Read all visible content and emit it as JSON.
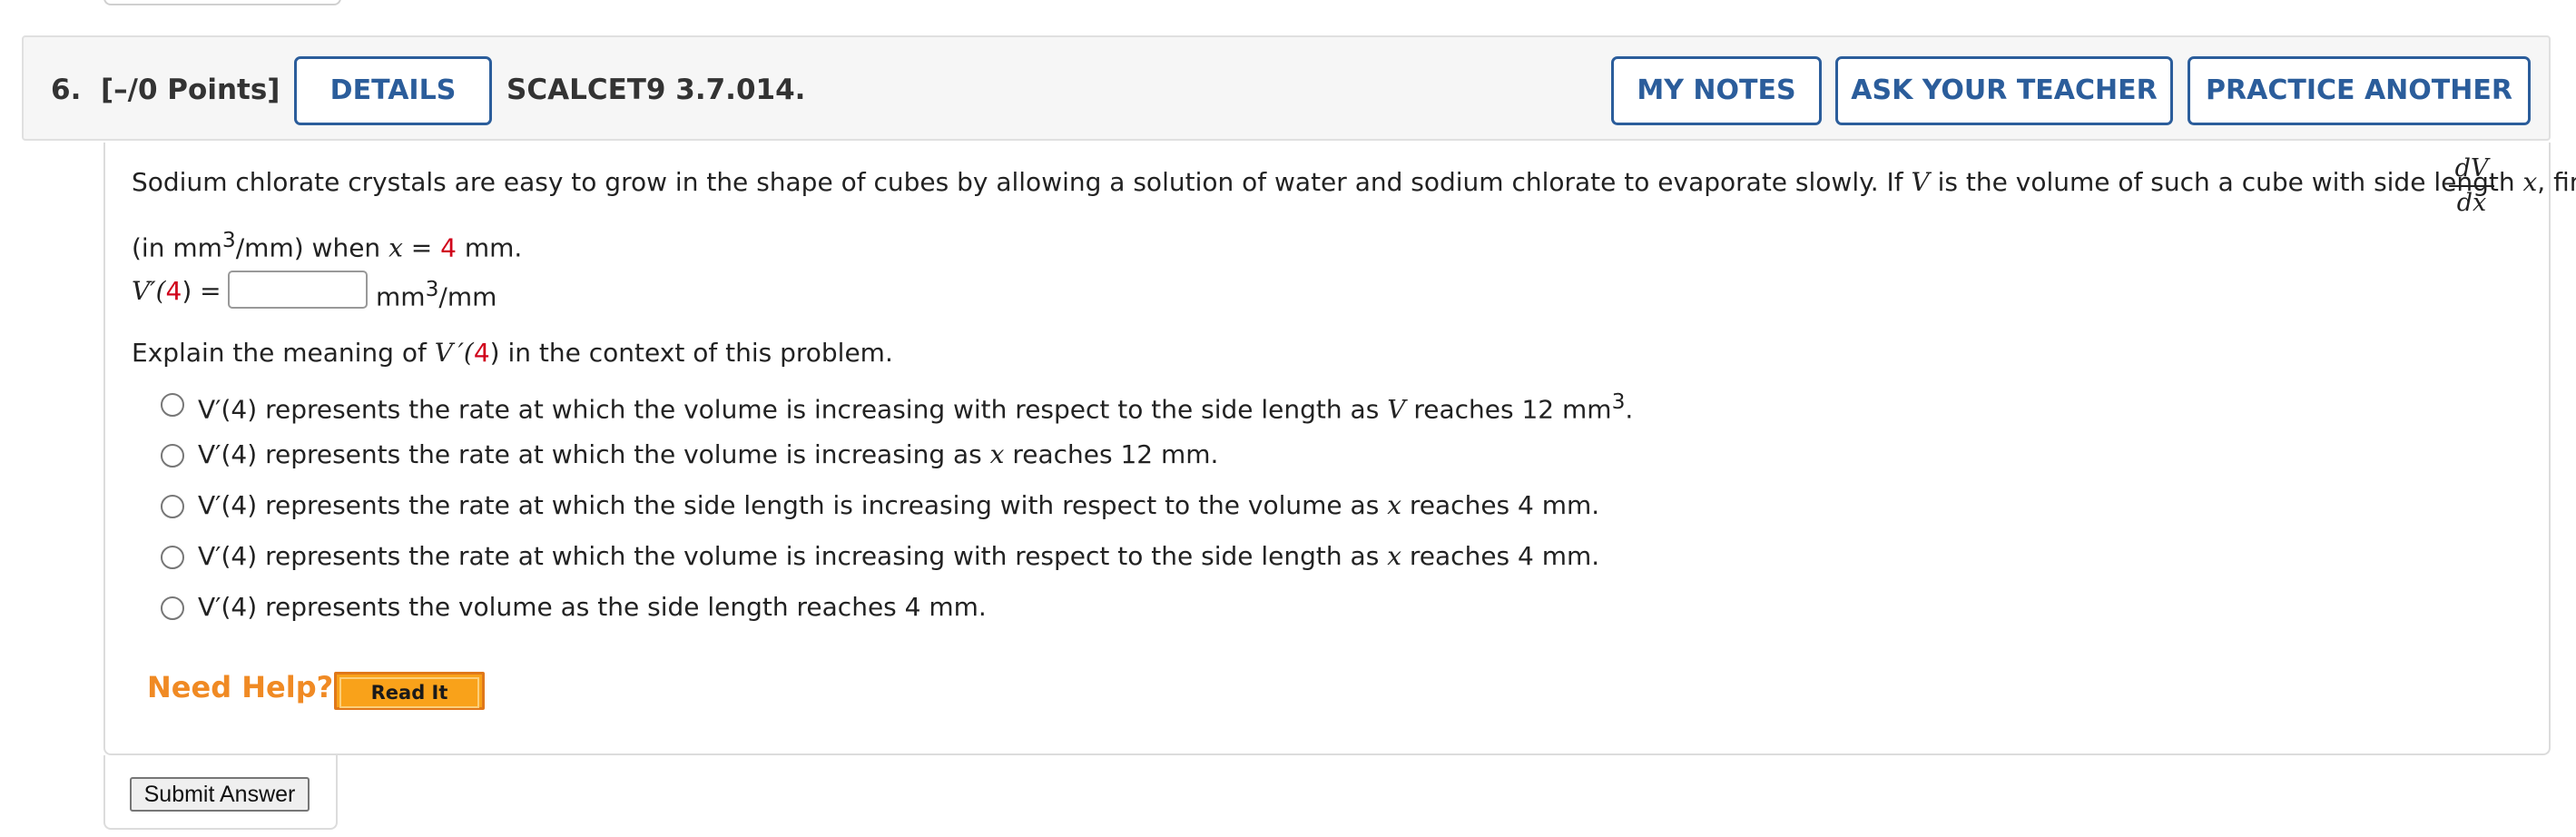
{
  "header": {
    "question_number": "6.",
    "points": "[–/0 Points]",
    "details_label": "DETAILS",
    "source_id": "SCALCET9 3.7.014.",
    "my_notes_label": "MY NOTES",
    "ask_teacher_label": "ASK YOUR TEACHER",
    "practice_label": "PRACTICE ANOTHER"
  },
  "problem": {
    "line1_pre": "Sodium chlorate crystals are easy to grow in the shape of cubes by allowing a solution of water and sodium chlorate to evaporate slowly. If ",
    "var_V": "V",
    "line1_mid": " is the volume of such a cube with side length ",
    "var_x": "x",
    "line1_post": ", find",
    "frac_num": "dV",
    "frac_den": "dx",
    "line2_pre": "(in mm",
    "sup3": "3",
    "line2_mid": "/mm) when ",
    "line2_eq": " = ",
    "x_value": "4",
    "line2_post": " mm.",
    "answer_prefix": "V′(",
    "answer_arg": "4",
    "answer_suffix": ") =",
    "answer_unit_pre": "mm",
    "answer_unit_post": "/mm",
    "answer_value": "",
    "explain_pre": "Explain the meaning of ",
    "explain_var": "V ′(",
    "explain_arg": "4",
    "explain_post": ") in the context of this problem."
  },
  "options": [
    {
      "prefix": "V′(4) represents the rate at which the volume is increasing with respect to the side length as ",
      "var": "V",
      "suffix": " reaches 12 mm",
      "sup": "3",
      "end": "."
    },
    {
      "prefix": "V′(4) represents the rate at which the volume is increasing as ",
      "var": "x",
      "suffix": " reaches 12 mm.",
      "sup": "",
      "end": ""
    },
    {
      "prefix": "V′(4) represents the rate at which the side length is increasing with respect to the volume as ",
      "var": "x",
      "suffix": " reaches 4 mm.",
      "sup": "",
      "end": ""
    },
    {
      "prefix": "V′(4) represents the rate at which the volume is increasing with respect to the side length as ",
      "var": "x",
      "suffix": " reaches 4 mm.",
      "sup": "",
      "end": ""
    },
    {
      "prefix": "V′(4) represents the volume as the side length reaches 4 mm.",
      "var": "",
      "suffix": "",
      "sup": "",
      "end": ""
    }
  ],
  "help": {
    "need_help_label": "Need Help?",
    "read_it_label": "Read It"
  },
  "submit_label": "Submit Answer",
  "colors": {
    "accent_blue": "#2b5d9b",
    "highlight_red": "#d0021b",
    "help_orange": "#f08a24",
    "read_it_bg": "#f9a21a"
  }
}
